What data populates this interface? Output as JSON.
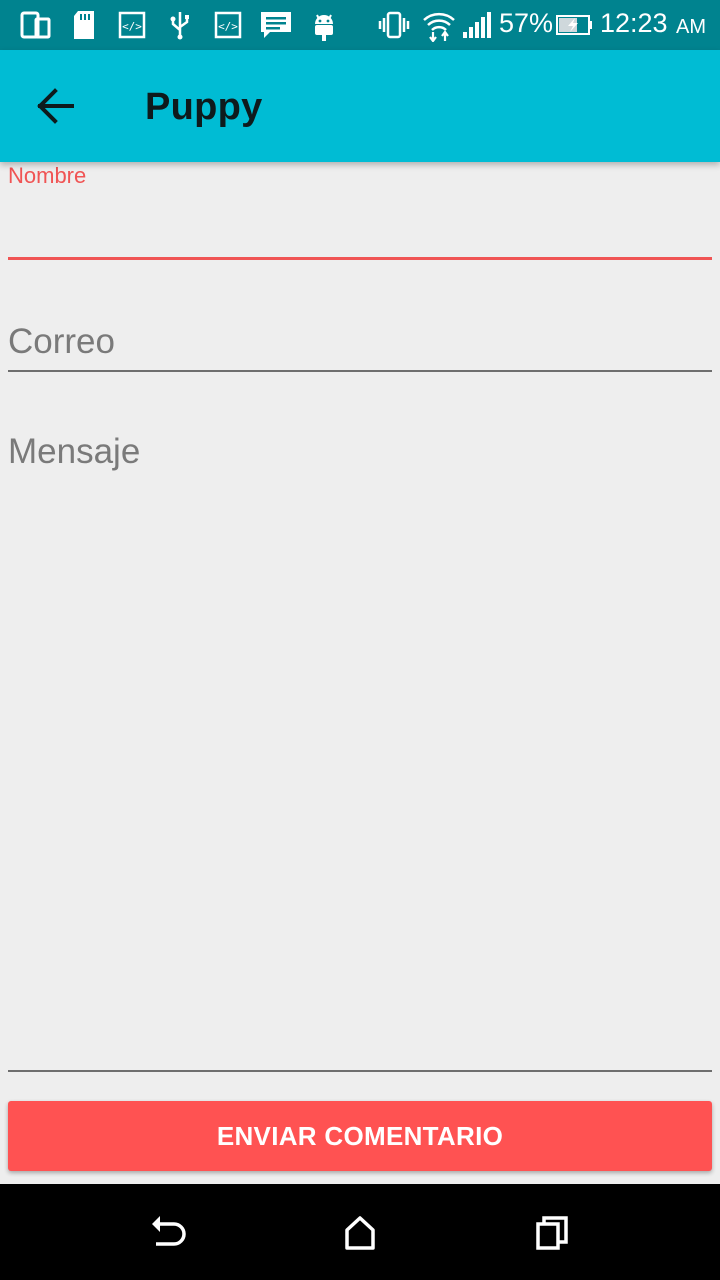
{
  "status_bar": {
    "battery_percent": "57%",
    "time": "12:23",
    "ampm": "AM",
    "icons": [
      "screen-mirror-icon",
      "sd-card-icon",
      "code-icon",
      "usb-icon",
      "code-icon",
      "message-icon",
      "android-icon",
      "vibrate-icon",
      "wifi-icon",
      "signal-icon",
      "battery-charging-icon"
    ]
  },
  "app_bar": {
    "title": "Puppy",
    "back_icon": "arrow-back-icon"
  },
  "form": {
    "nombre_label": "Nombre",
    "nombre_value": "",
    "correo_placeholder": "Correo",
    "mensaje_placeholder": "Mensaje",
    "submit_label": "ENVIAR COMENTARIO"
  },
  "colors": {
    "status_bar": "#00838f",
    "app_bar": "#00bcd4",
    "accent": "#ff5252",
    "background": "#eeeeee"
  },
  "nav_bar": {
    "icons": [
      "back-nav-icon",
      "home-icon",
      "recents-icon"
    ]
  }
}
